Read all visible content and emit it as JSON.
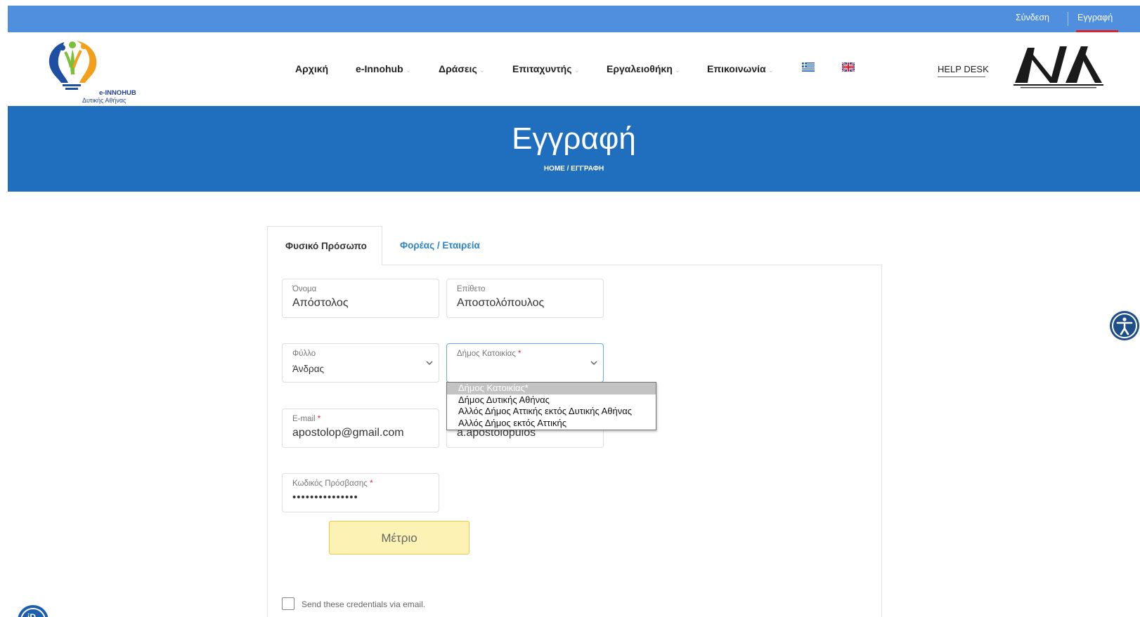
{
  "topbar": {
    "login": "Σύνδεση",
    "register": "Εγγραφή"
  },
  "logo": {
    "line1": "e-INNOHUB",
    "line2": "Δυτικής Αθήνας"
  },
  "nav": {
    "items": [
      {
        "label": "Αρχική",
        "has_menu": false
      },
      {
        "label": "e-Innohub",
        "has_menu": true
      },
      {
        "label": "Δράσεις",
        "has_menu": true
      },
      {
        "label": "Επιταχυντής",
        "has_menu": true
      },
      {
        "label": "Εργαλειοθήκη",
        "has_menu": true
      },
      {
        "label": "Επικοινωνία",
        "has_menu": true
      }
    ],
    "chevron": "⌄",
    "languages": [
      "greek-flag-icon",
      "uk-flag-icon"
    ],
    "helpdesk": "HELP DESK"
  },
  "banner": {
    "title": "Εγγραφή",
    "breadcrumb": "HOME  /  ΕΓΓΡΑΦΗ"
  },
  "tabs": {
    "individual": "Φυσικό Πρόσωπο",
    "organization": "Φορέας / Εταιρεία"
  },
  "form": {
    "first_name": {
      "label": "Όνομα",
      "value": "Απόστολος"
    },
    "last_name": {
      "label": "Επίθετο",
      "value": "Αποστολόπουλος"
    },
    "gender": {
      "label": "Φύλλο",
      "value": "Άνδρας"
    },
    "municipality": {
      "label": "Δήμος Κατοικίας",
      "value": "",
      "options": [
        "Δήμος Κατοικίας*",
        "Δήμος Δυτικής Αθήνας",
        "Αλλός Δήμος Αττικής εκτός Δυτικής Αθήνας",
        "Αλλός Δήμος εκτός Αττικής"
      ],
      "highlighted_option": "Δήμος Κατοικίας*"
    },
    "email": {
      "label": "E-mail",
      "value": "apostolop@gmail.com"
    },
    "username": {
      "value": "a.apostolopulos"
    },
    "password": {
      "label": "Κωδικός Πρόσβασης",
      "value": "•••••••••••••••"
    },
    "required_mark": "*",
    "password_strength": "Μέτριο",
    "send_credentials": {
      "label": "Send these credentials via email.",
      "checked": false
    }
  },
  "colors": {
    "topbar": "#4f8fde",
    "banner": "#1f6fbe",
    "tab_link": "#2d84c8",
    "required": "#e0263a",
    "strength_bg": "#fbf2b4"
  }
}
